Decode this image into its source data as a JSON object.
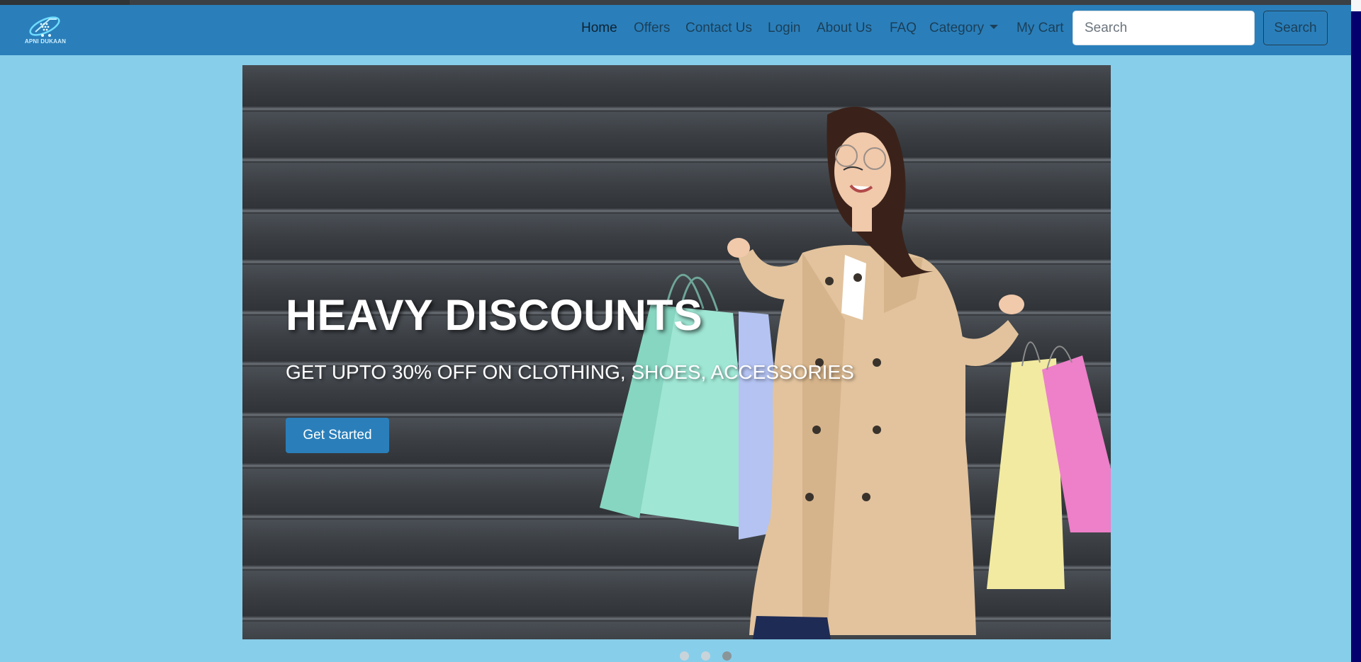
{
  "brand": {
    "logo_text": "APNI DUKAAN"
  },
  "nav": {
    "items": [
      {
        "label": "Home",
        "active": true
      },
      {
        "label": "Offers"
      },
      {
        "label": "Contact Us"
      },
      {
        "label": "Login"
      },
      {
        "label": "About Us"
      },
      {
        "label": "FAQ"
      },
      {
        "label": "Category",
        "dropdown": true
      },
      {
        "label": "My Cart"
      }
    ],
    "search": {
      "placeholder": "Search",
      "button_label": "Search"
    }
  },
  "hero": {
    "heading": "HEAVY DISCOUNTS",
    "subheading": "GET UPTO 30% OFF ON CLOTHING, SHOES, ACCESSORIES",
    "cta_label": "Get Started",
    "slides_count": 3,
    "active_slide": 3
  },
  "colors": {
    "navbar": "#2a7fba",
    "page_background": "#87ceeb",
    "cta": "#2a7fba",
    "wall": "#3a3e43"
  },
  "icons": {
    "logo": "cart-globe-logo-icon",
    "dropdown": "caret-down-icon"
  }
}
